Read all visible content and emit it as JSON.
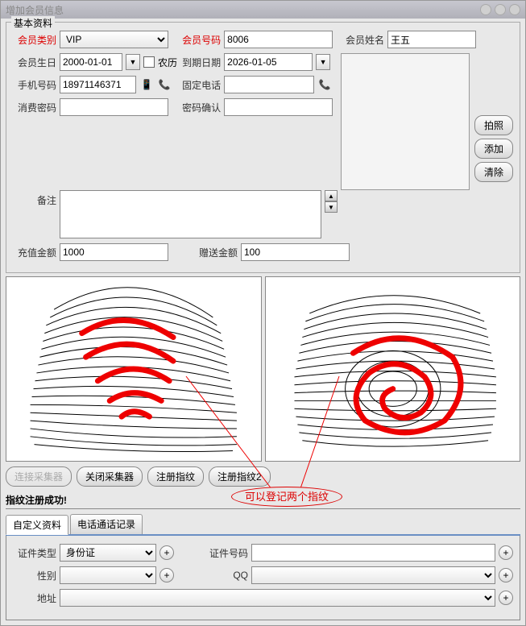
{
  "window": {
    "title": "增加会员信息"
  },
  "group_basic_info": "基本资料",
  "labels": {
    "member_type": "会员类别",
    "member_code": "会员号码",
    "member_name": "会员姓名",
    "birthday": "会员生日",
    "lunar": "农历",
    "expiry": "到期日期",
    "phone": "手机号码",
    "fixed_phone": "固定电话",
    "consume_pwd": "消费密码",
    "pwd_confirm": "密码确认",
    "remark": "备注",
    "recharge_amt": "充值金额",
    "gift_amt": "赠送金额",
    "id_type": "证件类型",
    "id_number": "证件号码",
    "gender": "性别",
    "qq": "QQ",
    "address": "地址"
  },
  "values": {
    "member_type": "VIP",
    "member_code": "8006",
    "member_name": "王五",
    "birthday": "2000-01-01",
    "expiry": "2026-01-05",
    "phone": "18971146371",
    "fixed_phone": "",
    "consume_pwd": "",
    "pwd_confirm": "",
    "remark": "",
    "recharge_amt": "1000",
    "gift_amt": "100",
    "id_type": "身份证",
    "id_number": "",
    "gender": "",
    "qq": "",
    "address": ""
  },
  "buttons": {
    "take_photo": "拍照",
    "add": "添加",
    "clear": "清除",
    "connect_collector": "连接采集器",
    "close_collector": "关闭采集器",
    "register_fp": "注册指纹",
    "register_fp2": "注册指纹2"
  },
  "status": "指纹注册成功!",
  "annotation": "可以登记两个指纹",
  "tabs": {
    "custom_data": "自定义资料",
    "call_log": "电话通话记录"
  }
}
